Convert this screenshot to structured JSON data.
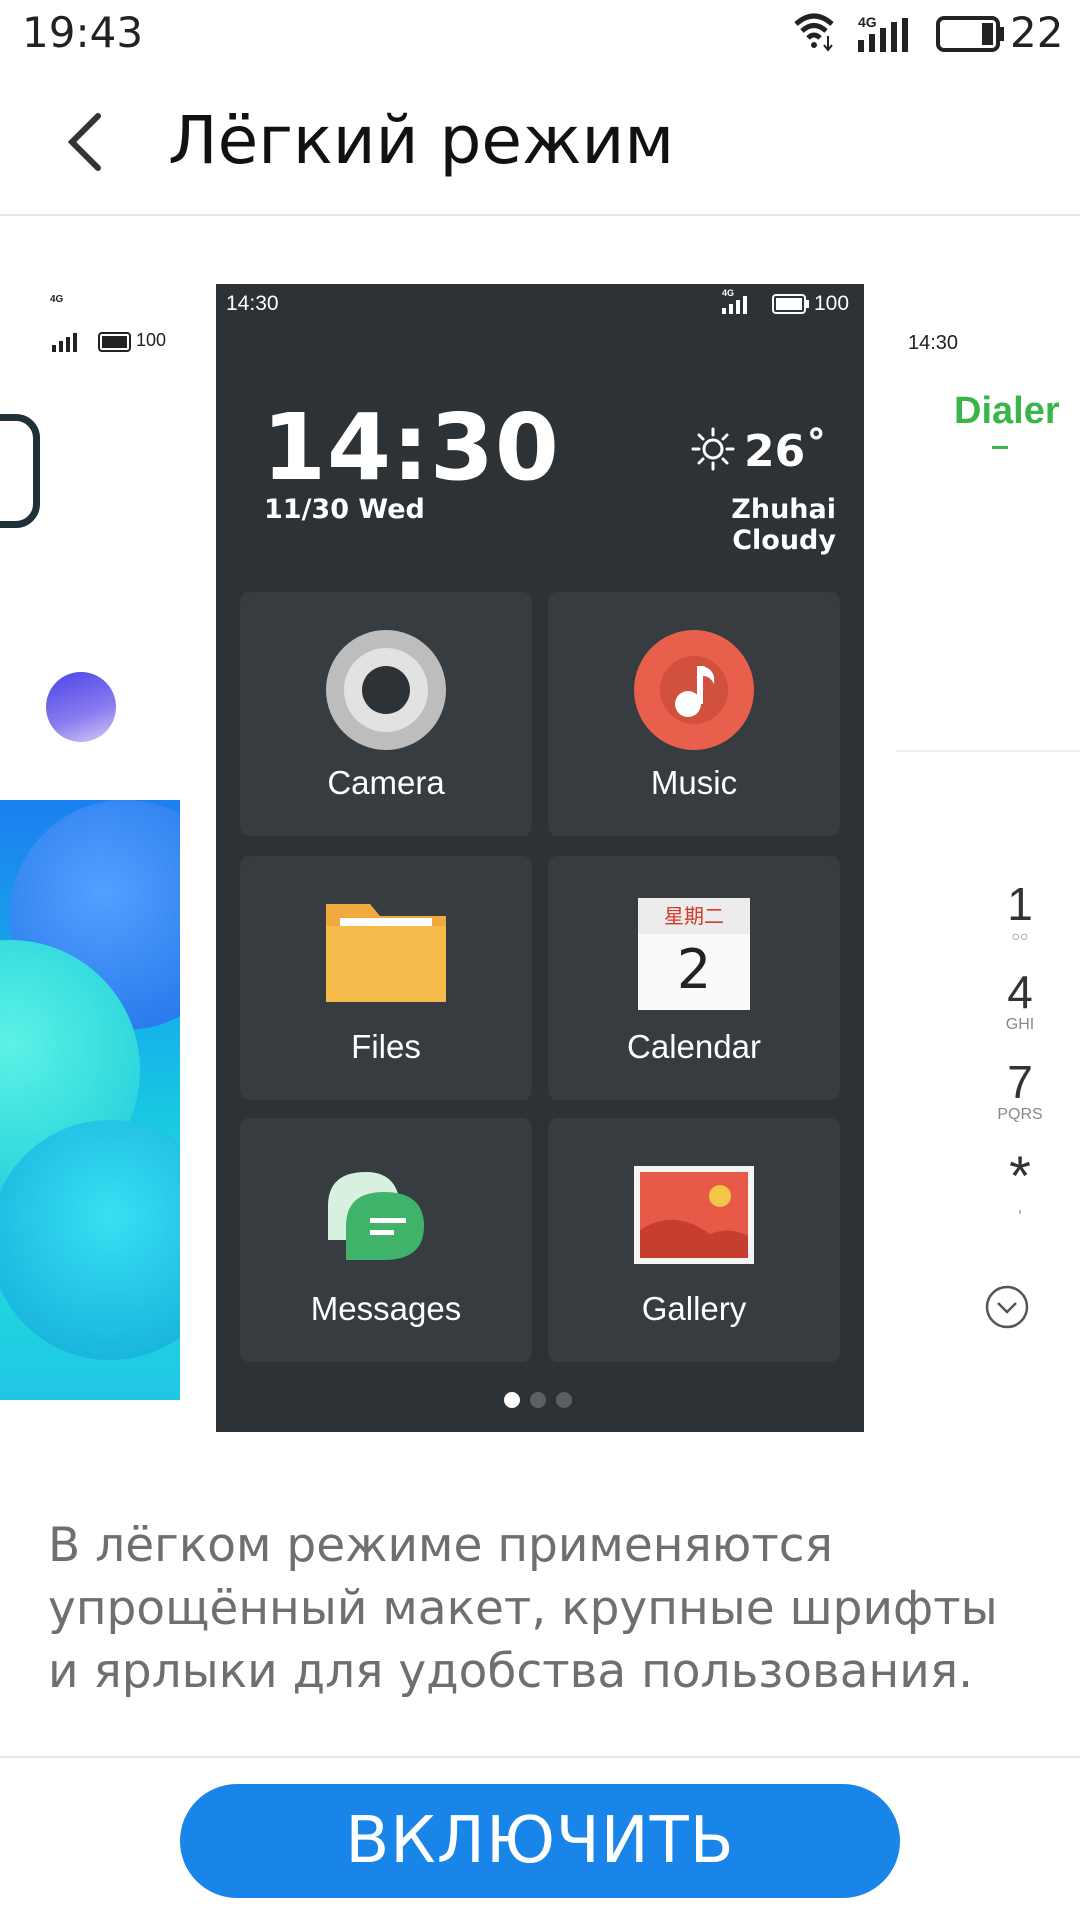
{
  "status_bar": {
    "time": "19:43",
    "network": "4G",
    "battery": "22"
  },
  "header": {
    "title": "Лёгкий режим"
  },
  "preview": {
    "left_status_network": "4G",
    "left_status_battery": "100",
    "center": {
      "status_time": "14:30",
      "status_network": "4G",
      "status_battery": "100",
      "clock": "14:30",
      "date": "11/30  Wed",
      "temperature": "26˚",
      "location": "Zhuhai  Cloudy",
      "apps": [
        {
          "label": "Camera"
        },
        {
          "label": "Music"
        },
        {
          "label": "Files"
        },
        {
          "label": "Calendar",
          "weekday": "星期二",
          "day": "2"
        },
        {
          "label": "Messages"
        },
        {
          "label": "Gallery"
        }
      ],
      "page_count": 3,
      "active_page": 1
    },
    "right": {
      "status_time": "14:30",
      "title": "Dialer",
      "keys": [
        {
          "digit": "1",
          "sub": "○○"
        },
        {
          "digit": "4",
          "sub": "GHI"
        },
        {
          "digit": "7",
          "sub": "PQRS"
        },
        {
          "digit": "*",
          "sub": ","
        }
      ]
    }
  },
  "description": "В лёгком режиме применяются упрощённый макет, крупные шрифты и ярлыки для удобства пользования.",
  "enable_button": {
    "label": "ВКЛЮЧИТЬ"
  },
  "colors": {
    "accent": "#1a85e8",
    "dialer_green": "#3bb54a",
    "phone_bg": "#2c3235",
    "tile_bg": "#363c40"
  }
}
